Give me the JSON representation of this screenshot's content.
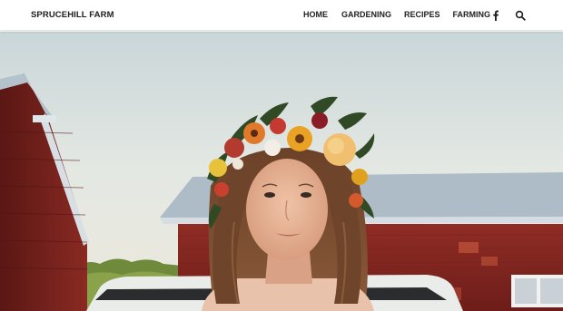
{
  "brand": {
    "name": "SPRUCEHILL FARM"
  },
  "nav": {
    "items": [
      {
        "label": "HOME"
      },
      {
        "label": "GARDENING"
      },
      {
        "label": "RECIPES"
      },
      {
        "label": "FARMING"
      }
    ],
    "icons": [
      "facebook-icon",
      "search-icon"
    ]
  },
  "hero": {
    "image": "girl-with-flower-crown-in-front-of-red-barns",
    "colors": {
      "barn_red": "#8e2a24",
      "roof": "#a9b9c6",
      "sky": "#d9e2e1"
    }
  }
}
